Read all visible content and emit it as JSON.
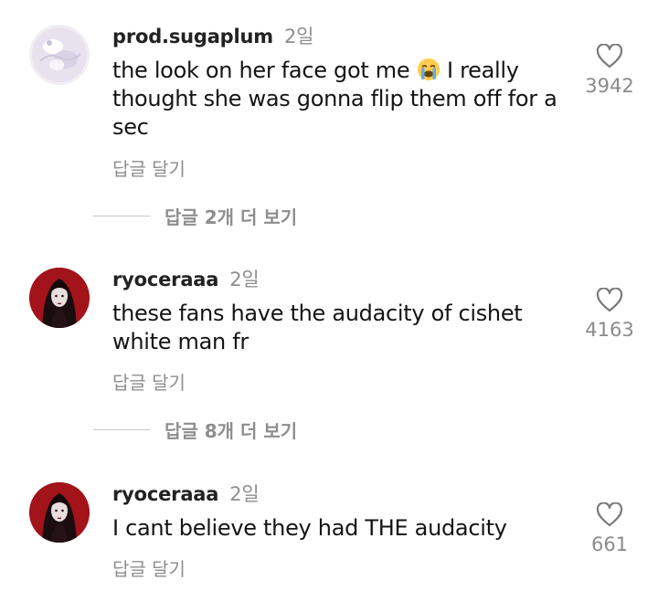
{
  "comments": [
    {
      "username": "prod.sugaplum",
      "time": "2일",
      "text_before_emoji": "the look on her face got me ",
      "emoji_icon": "loudly-crying-face-icon",
      "text_after_emoji": " I really thought she was gonna flip them off for a sec",
      "reply_label": "답글 달기",
      "likes": "3942"
    },
    {
      "username": "ryoceraaa",
      "time": "2일",
      "text": "these fans have the audacity of cishet white man fr",
      "reply_label": "답글 달기",
      "likes": "4163"
    },
    {
      "username": "ryoceraaa",
      "time": "2일",
      "text": "I cant believe they had THE audacity",
      "reply_label": "답글 달기",
      "likes": "661"
    }
  ],
  "view_replies": [
    {
      "label": "답글 2개 더 보기"
    },
    {
      "label": "답글 8개 더 보기"
    }
  ],
  "colors": {
    "text": "#141414",
    "muted": "#8e8e8e",
    "avatar_red": "#9b1016"
  }
}
